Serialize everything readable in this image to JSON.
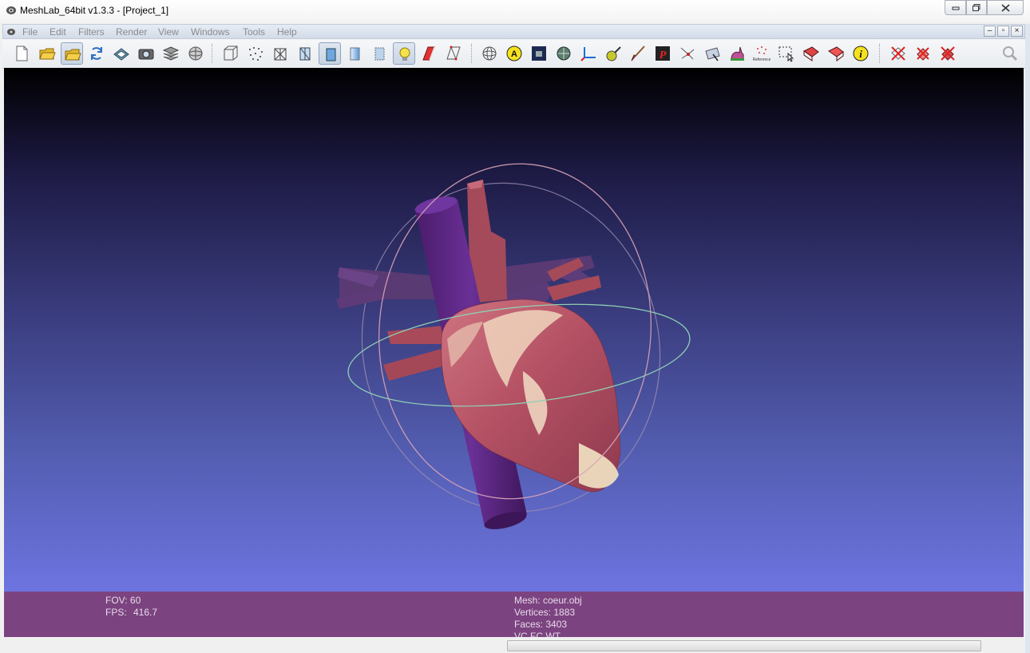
{
  "window": {
    "title": "MeshLab_64bit v1.3.3 - [Project_1]"
  },
  "menu": [
    "File",
    "Edit",
    "Filters",
    "Render",
    "View",
    "Windows",
    "Tools",
    "Help"
  ],
  "mdi_buttons": [
    "–",
    "▫",
    "×"
  ],
  "toolbar": {
    "icons": [
      "new-document-icon",
      "open-folder-icon",
      "open-project-icon",
      "reload-icon",
      "save-icon",
      "snapshot-icon",
      "layers-icon",
      "globe-icon",
      "bounding-box-icon",
      "points-icon",
      "wireframe-icon",
      "hidden-lines-icon",
      "flat-shading-icon",
      "smooth-shading-icon",
      "texture-icon",
      "light-icon",
      "backface-icon",
      "selected-faces-icon",
      "trackball-icon",
      "annotation-icon",
      "image-icon",
      "measure-icon",
      "axis-icon",
      "paint-icon",
      "brush-icon",
      "pickpoints-icon",
      "align-icon",
      "manipulate-icon",
      "bunny-icon",
      "reference-icon",
      "select-rect-icon",
      "select-vertex-icon",
      "select-faces-icon",
      "info-icon",
      "delete-vertex-icon",
      "delete-face-icon",
      "delete-face-vertex-icon",
      "search-icon"
    ]
  },
  "info": {
    "fov": "FOV: 60",
    "fps_label": "FPS:",
    "fps_value": "416.7",
    "mesh": "Mesh: coeur.obj",
    "vertices": "Vertices: 1883",
    "faces": "Faces: 3403",
    "flags": "VC FC WT"
  },
  "colors": {
    "viewport_top": "#000000",
    "viewport_bottom": "#6d74e0",
    "info_panel": "#7c4381",
    "heart": "#b9566a",
    "vena_cava": "#5a2a7c"
  }
}
